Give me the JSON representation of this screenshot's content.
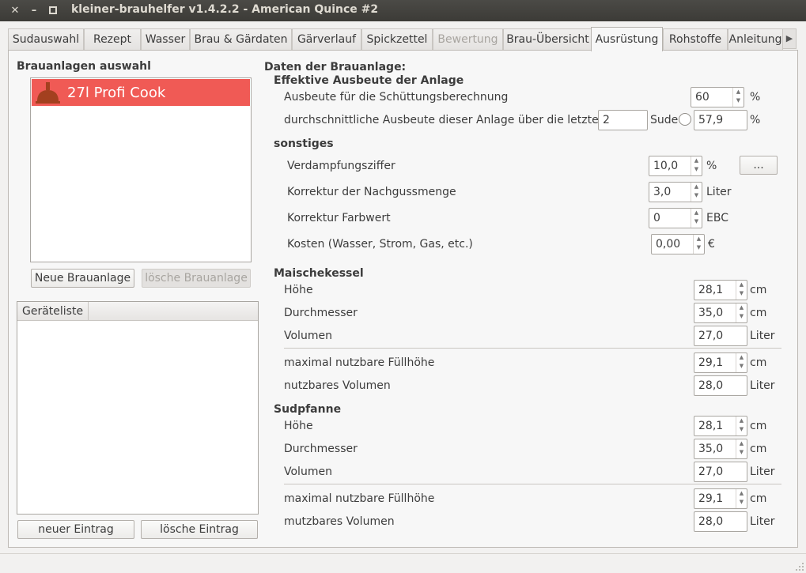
{
  "window": {
    "title": "kleiner-brauhelfer v1.4.2.2 - American Quince #2",
    "close_glyph": "✕",
    "minimize_glyph": "–",
    "maximize_glyph": "▫"
  },
  "tabs": [
    {
      "label": "Sudauswahl",
      "state": "normal"
    },
    {
      "label": "Rezept",
      "state": "normal"
    },
    {
      "label": "Wasser",
      "state": "normal"
    },
    {
      "label": "Brau & Gärdaten",
      "state": "normal"
    },
    {
      "label": "Gärverlauf",
      "state": "normal"
    },
    {
      "label": "Spickzettel",
      "state": "normal"
    },
    {
      "label": "Bewertung",
      "state": "disabled"
    },
    {
      "label": "Brau-Übersicht",
      "state": "normal"
    },
    {
      "label": "Ausrüstung",
      "state": "active"
    },
    {
      "label": "Rohstoffe",
      "state": "normal"
    },
    {
      "label": "Anleitung",
      "state": "normal"
    }
  ],
  "tab_scroll_glyph": "▶",
  "left": {
    "section_title": "Brauanlagen auswahl",
    "selected_anlage": "27l Profi Cook",
    "selection_color": "#f05a55",
    "new_button": "Neue Brauanlage",
    "delete_button": "lösche Brauanlage",
    "table_header": "Geräteliste",
    "new_entry_button": "neuer Eintrag",
    "delete_entry_button": "lösche Eintrag"
  },
  "right": {
    "title": "Daten der Brauanlage:",
    "effektive": {
      "title": "Effektive Ausbeute der Anlage",
      "ausbeute_label": "Ausbeute für die Schüttungsberechnung",
      "ausbeute_value": "60",
      "ausbeute_unit": "%",
      "durchschnitt_label": "durchschnittliche Ausbeute dieser Anlage über die letzten",
      "sude_value": "2",
      "sude_unit": "Sude",
      "durchschnitt_value": "57,9",
      "durchschnitt_unit": "%"
    },
    "sonstiges": {
      "title": "sonstiges",
      "verdampfung_label": "Verdampfungsziffer",
      "verdampfung_value": "10,0",
      "verdampfung_unit": "%",
      "more_button": "...",
      "nachguss_label": "Korrektur der Nachgussmenge",
      "nachguss_value": "3,0",
      "nachguss_unit": "Liter",
      "farbwert_label": "Korrektur Farbwert",
      "farbwert_value": "0",
      "farbwert_unit": "EBC",
      "kosten_label": "Kosten (Wasser, Strom, Gas, etc.)",
      "kosten_value": "0,00",
      "kosten_unit": "€"
    },
    "maischekessel": {
      "title": "Maischekessel",
      "hoehe_label": "Höhe",
      "hoehe_value": "28,1",
      "hoehe_unit": "cm",
      "durchmesser_label": "Durchmesser",
      "durchmesser_value": "35,0",
      "durchmesser_unit": "cm",
      "volumen_label": "Volumen",
      "volumen_value": "27,0",
      "volumen_unit": "Liter",
      "fuellhoehe_label": "maximal nutzbare Füllhöhe",
      "fuellhoehe_value": "29,1",
      "fuellhoehe_unit": "cm",
      "nutzvolumen_label": "nutzbares Volumen",
      "nutzvolumen_value": "28,0",
      "nutzvolumen_unit": "Liter"
    },
    "sudpfanne": {
      "title": "Sudpfanne",
      "hoehe_label": "Höhe",
      "hoehe_value": "28,1",
      "hoehe_unit": "cm",
      "durchmesser_label": "Durchmesser",
      "durchmesser_value": "35,0",
      "durchmesser_unit": "cm",
      "volumen_label": "Volumen",
      "volumen_value": "27,0",
      "volumen_unit": "Liter",
      "fuellhoehe_label": "maximal nutzbare Füllhöhe",
      "fuellhoehe_value": "29,1",
      "fuellhoehe_unit": "cm",
      "nutzvolumen_label": "mutzbares Volumen",
      "nutzvolumen_value": "28,0",
      "nutzvolumen_unit": "Liter"
    }
  }
}
